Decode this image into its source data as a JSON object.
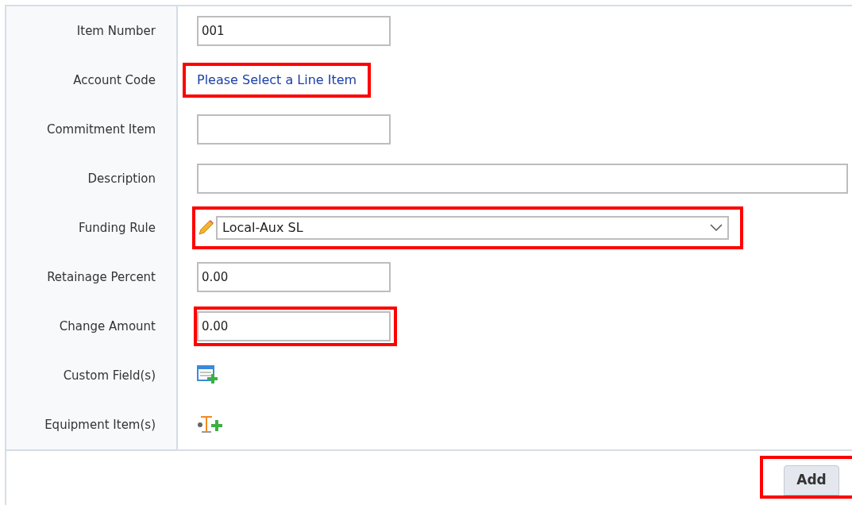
{
  "fields": [
    {
      "label": "Item Number",
      "kind": "input",
      "value": "001",
      "highlighted": false
    },
    {
      "label": "Account Code",
      "kind": "link",
      "value": "Please Select a Line Item",
      "highlighted": true
    },
    {
      "label": "Commitment Item",
      "kind": "input",
      "highlighted": false
    },
    {
      "label": "Description",
      "kind": "wide-input",
      "highlighted": false
    },
    {
      "label": "Funding Rule",
      "kind": "select",
      "value": "Local-Aux SL",
      "highlighted": true
    },
    {
      "label": "Retainage Percent",
      "kind": "input",
      "value": "0.00",
      "highlighted": false
    },
    {
      "label": "Change Amount",
      "kind": "input",
      "value": "0.00",
      "highlighted": true
    },
    {
      "label": "Custom Field(s)",
      "kind": "table-add",
      "highlighted": false
    },
    {
      "label": "Equipment Item(s)",
      "kind": "equipment-add",
      "highlighted": false
    }
  ],
  "add_button": {
    "label": "Add",
    "highlighted": true
  }
}
